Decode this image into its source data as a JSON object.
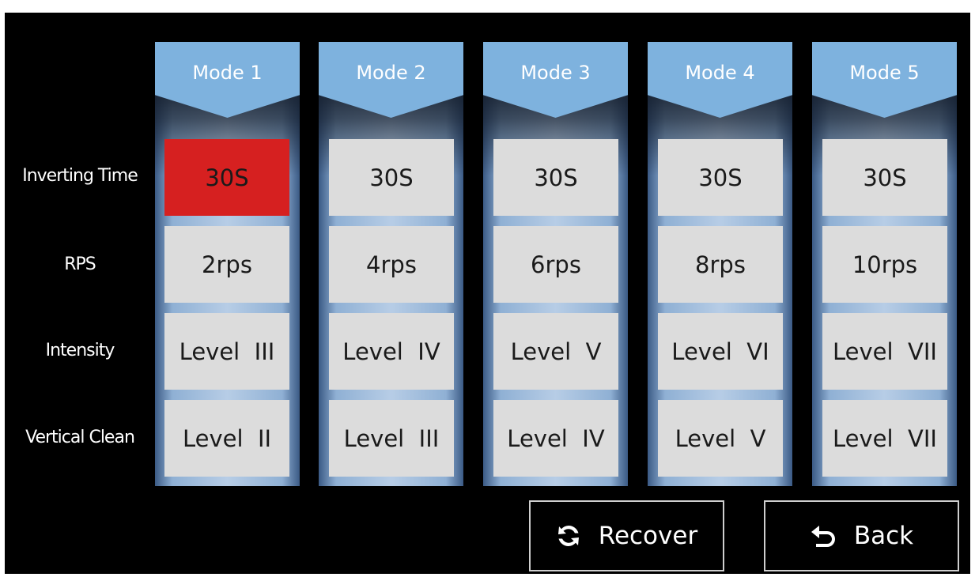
{
  "row_labels": [
    "Inverting Time",
    "RPS",
    "Intensity",
    "Vertical Clean"
  ],
  "modes": [
    {
      "title": "Mode 1",
      "inverting_time": "30S",
      "rps": "2rps",
      "intensity": "Level  III",
      "vertical_clean": "Level  II"
    },
    {
      "title": "Mode 2",
      "inverting_time": "30S",
      "rps": "4rps",
      "intensity": "Level  IV",
      "vertical_clean": "Level  III"
    },
    {
      "title": "Mode 3",
      "inverting_time": "30S",
      "rps": "6rps",
      "intensity": "Level  V",
      "vertical_clean": "Level  IV"
    },
    {
      "title": "Mode 4",
      "inverting_time": "30S",
      "rps": "8rps",
      "intensity": "Level  VI",
      "vertical_clean": "Level  V"
    },
    {
      "title": "Mode 5",
      "inverting_time": "30S",
      "rps": "10rps",
      "intensity": "Level  VII",
      "vertical_clean": "Level  VII"
    }
  ],
  "selected_cell": "Mode 1 / Inverting Time",
  "buttons": {
    "recover_label": "Recover",
    "recover_icon": "refresh-icon",
    "back_label": "Back",
    "back_icon": "undo-arrow-icon"
  },
  "colors": {
    "background": "#000000",
    "header": "#7eb2de",
    "cell": "#dcdcdc",
    "selected": "#d62020",
    "column_frame": "#8fb0d4"
  }
}
